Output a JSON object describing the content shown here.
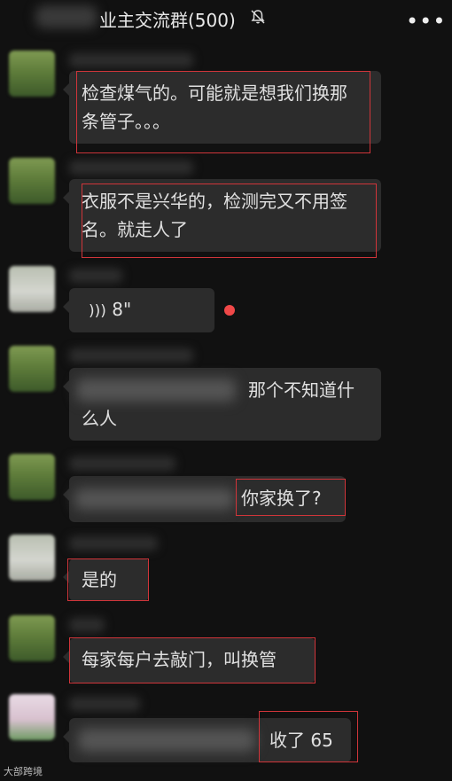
{
  "header": {
    "title": "业主交流群(500)",
    "mute_icon": "bell-off-icon",
    "more_icon": "more-dots-icon",
    "more_label": "•••"
  },
  "messages": [
    {
      "line1": "检查煤气的。可能就是想我们换那",
      "line2": "条管子。。。"
    },
    {
      "line1": "衣服不是兴华的，检测完又不用签",
      "line2": "名。就走人了"
    },
    {
      "voice_label": "8\"",
      "voice_icon": "voice-wave-icon",
      "unread": true
    },
    {
      "text_right": "那个不知道什",
      "line2": "么人"
    },
    {
      "text_right": "你家换了?"
    },
    {
      "text": "是的"
    },
    {
      "text": "每家每户去敲门，叫换管"
    },
    {
      "text_right": "收了 65"
    }
  ],
  "watermark": "大部跨境",
  "colors": {
    "background": "#111111",
    "bubble": "#2c2c2c",
    "highlight": "#d0353a",
    "unread": "#f04848"
  }
}
